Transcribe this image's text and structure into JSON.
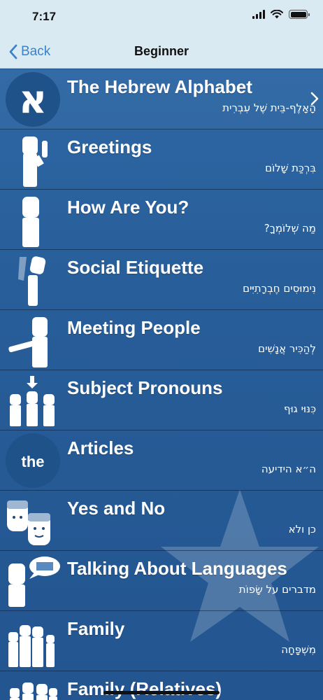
{
  "status": {
    "time": "7:17"
  },
  "nav": {
    "back_label": "Back",
    "title": "Beginner"
  },
  "lessons": [
    {
      "title": "The Hebrew Alphabet",
      "subtitle": "הָאָלֶף-בֵּית שֶׁל עִבְרִית",
      "icon": "hebrew-letter-aleph-icon",
      "icon_text": "א"
    },
    {
      "title": "Greetings",
      "subtitle": "בִּרְכַּת שָׁלוֹם",
      "icon": "person-waving-icon"
    },
    {
      "title": "How Are You?",
      "subtitle": "מַה שְׁלוֹמְךָ?",
      "icon": "person-standing-icon"
    },
    {
      "title": "Social Etiquette",
      "subtitle": "נִימוּסִים חֶבְרָתִיִּים",
      "icon": "person-bowing-icon"
    },
    {
      "title": "Meeting People",
      "subtitle": "לְהַכִּיר אֲנָשִׁים",
      "icon": "person-handshake-icon"
    },
    {
      "title": "Subject Pronouns",
      "subtitle": "כִּנּוּי גוּף",
      "icon": "people-pointer-icon"
    },
    {
      "title": "Articles",
      "subtitle": "ה״א הידיעה",
      "icon": "article-the-icon",
      "icon_text": "the"
    },
    {
      "title": "Yes and No",
      "subtitle": "כן ולא",
      "icon": "faces-nodding-icon"
    },
    {
      "title": "Talking About Languages",
      "subtitle": "מדברים על שָׂפוֹת",
      "icon": "person-speech-bubble-icon"
    },
    {
      "title": "Family",
      "subtitle": "מִשְׁפָּחָה",
      "icon": "family-group-icon"
    },
    {
      "title": "Family (Relatives)",
      "subtitle": "",
      "icon": "family-relatives-icon"
    }
  ],
  "colors": {
    "header_bg": "#d9eaf3",
    "list_bg": "#275d98",
    "accent": "#3b82c9"
  }
}
